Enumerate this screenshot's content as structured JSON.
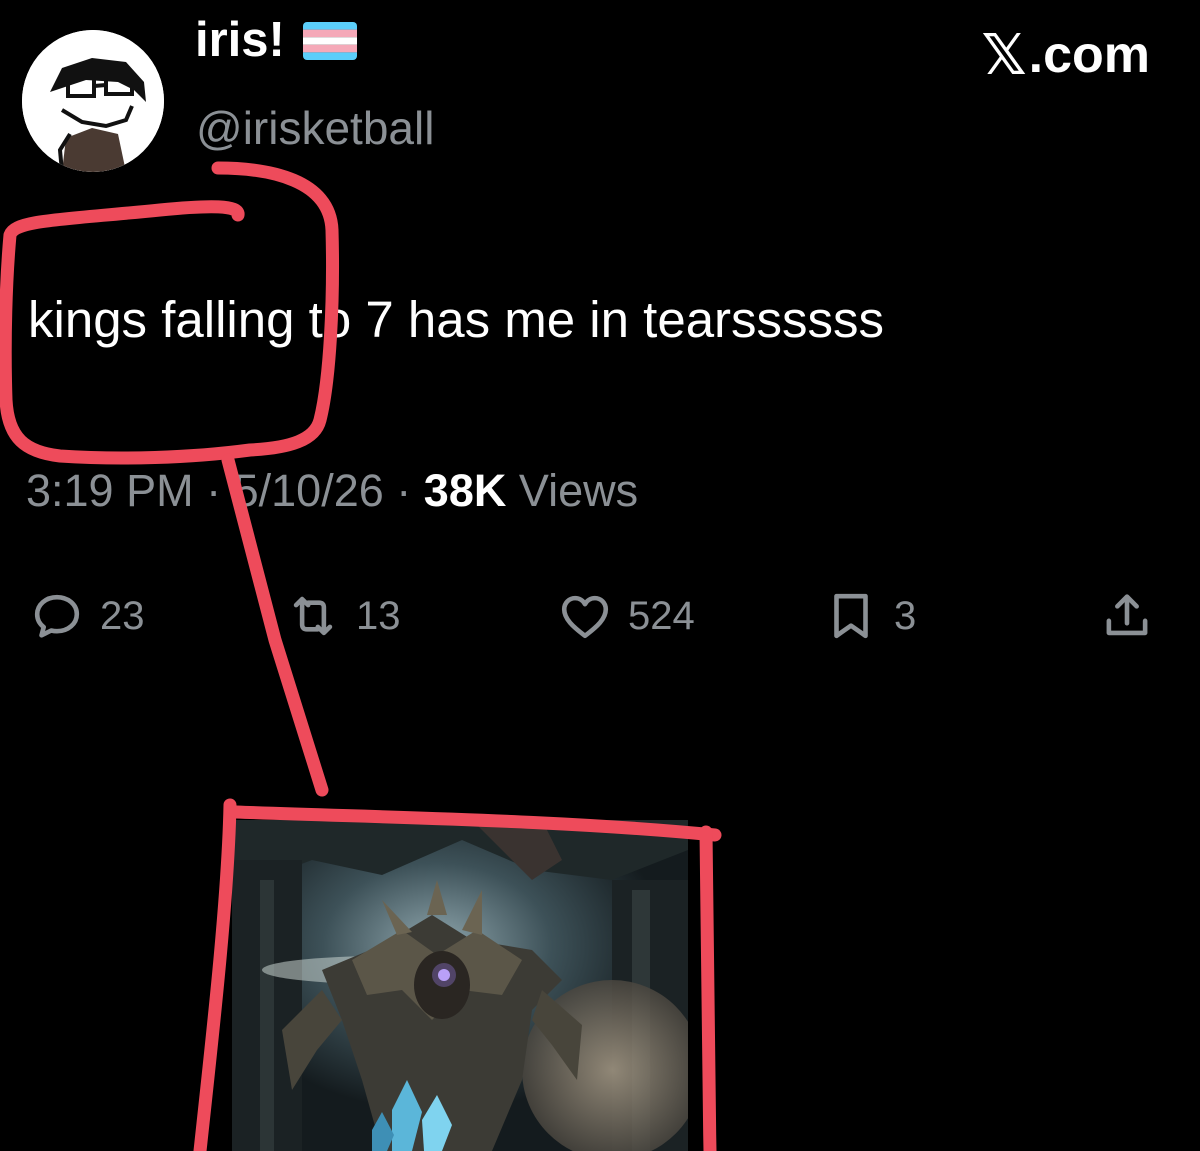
{
  "tweet": {
    "display_name": "iris!",
    "handle": "@irisketball",
    "brand_label": ".com",
    "brand_icon": "x-logo-icon",
    "text": "kings falling to 7 has me in tearssssss",
    "meta": {
      "time": "3:19 PM",
      "separator": "·",
      "date": "5/10/26",
      "views_count": "38K",
      "views_label": "Views"
    },
    "actions": {
      "replies": "23",
      "reposts": "13",
      "likes": "524",
      "bookmarks": "3"
    }
  },
  "colors": {
    "background": "#000000",
    "text": "#ffffff",
    "muted": "#8b9095",
    "annotation": "#ee4b5b"
  }
}
